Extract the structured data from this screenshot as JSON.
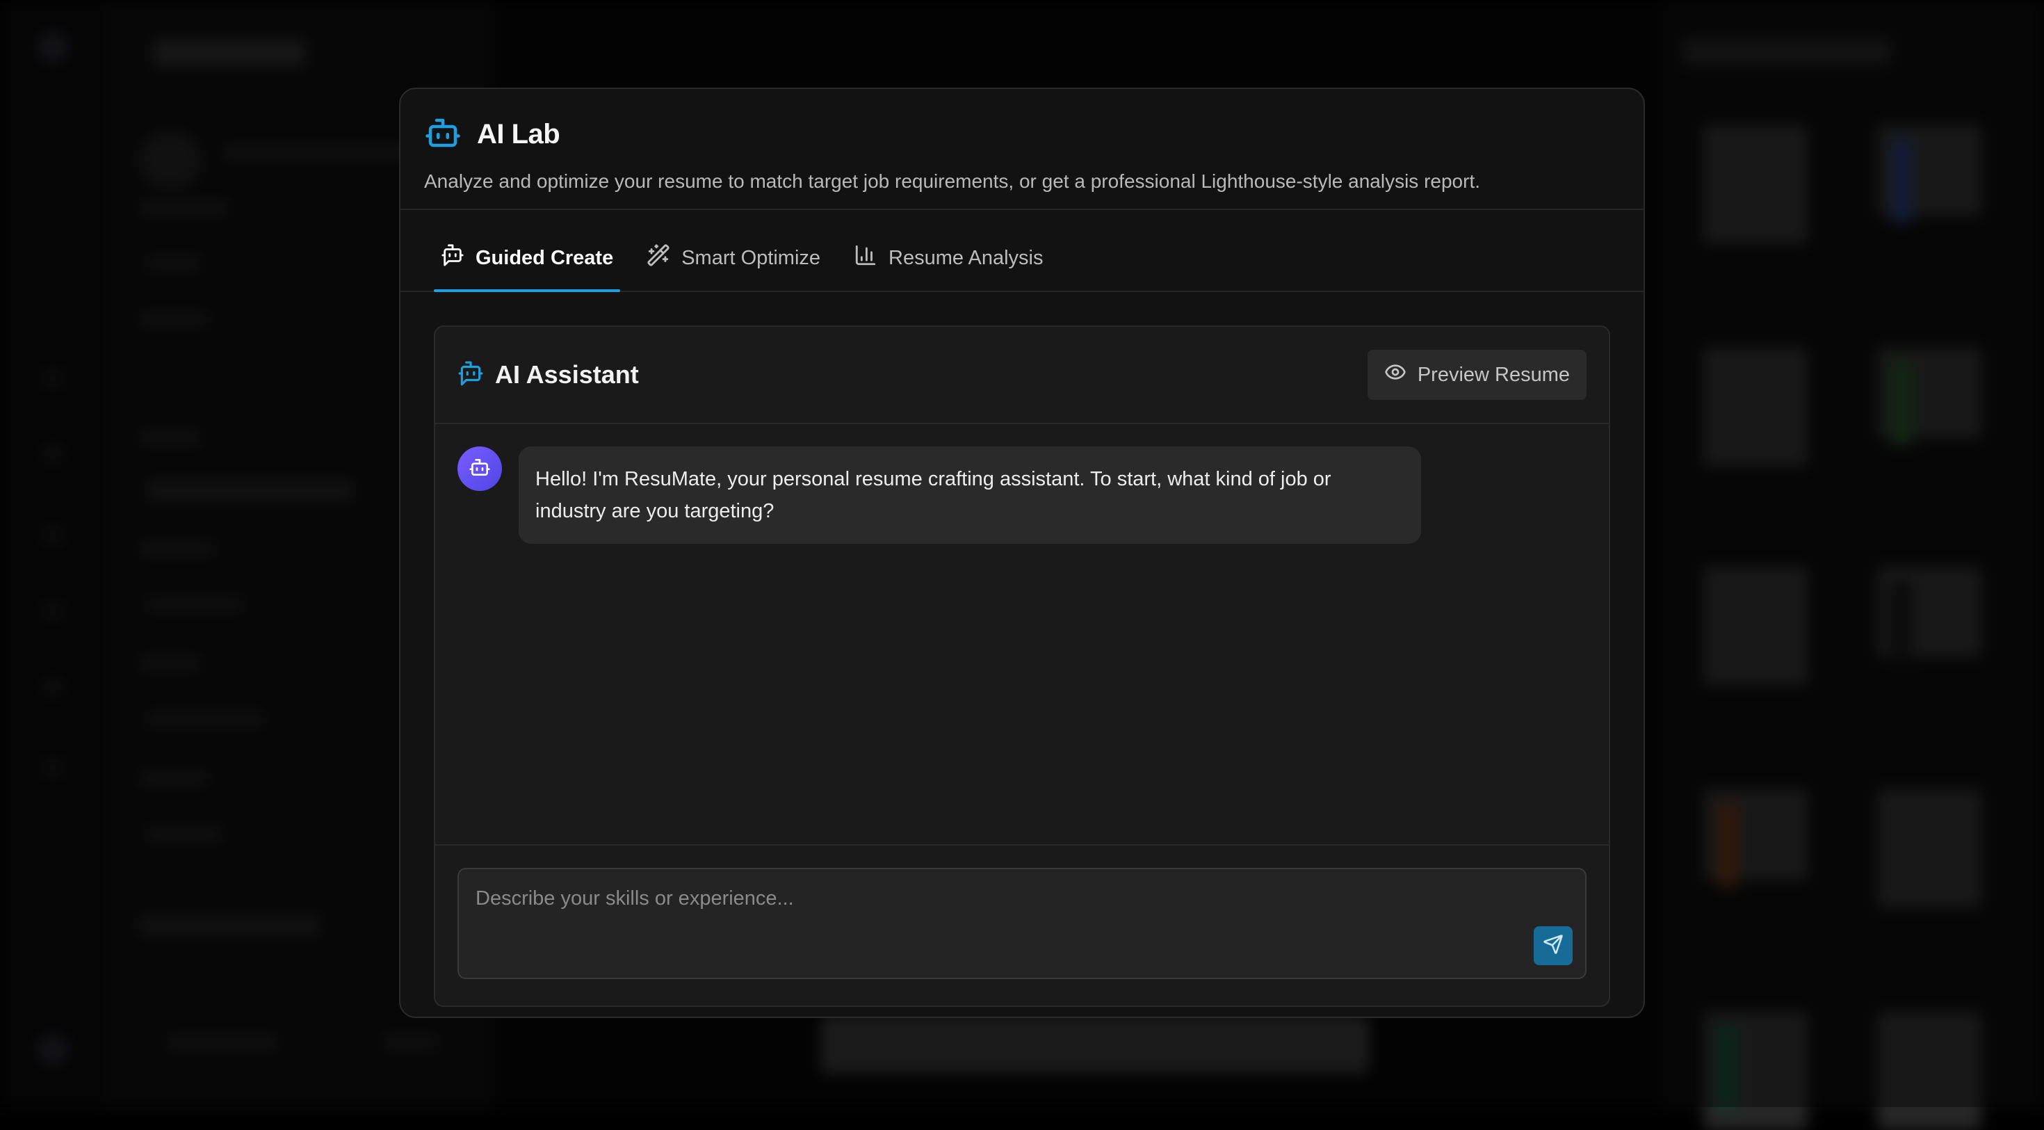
{
  "modal": {
    "title": "AI Lab",
    "description": "Analyze and optimize your resume to match target job requirements, or get a professional Lighthouse-style analysis report.",
    "icon": "robot-icon"
  },
  "tabs": [
    {
      "label": "Guided Create",
      "icon": "bot-message-icon",
      "active": true
    },
    {
      "label": "Smart Optimize",
      "icon": "magic-wand-icon",
      "active": false
    },
    {
      "label": "Resume Analysis",
      "icon": "bar-chart-icon",
      "active": false
    }
  ],
  "assistant": {
    "title": "AI Assistant",
    "preview_label": "Preview Resume",
    "messages": [
      {
        "role": "assistant",
        "text": "Hello! I'm ResuMate, your personal resume crafting assistant. To start, what kind of job or industry are you targeting?"
      }
    ],
    "input_placeholder": "Describe your skills or experience...",
    "input_value": ""
  },
  "colors": {
    "accent": "#1ea0e0",
    "send_button": "#176b97",
    "avatar_gradient_start": "#7a5cff",
    "avatar_gradient_end": "#4f46e5"
  }
}
